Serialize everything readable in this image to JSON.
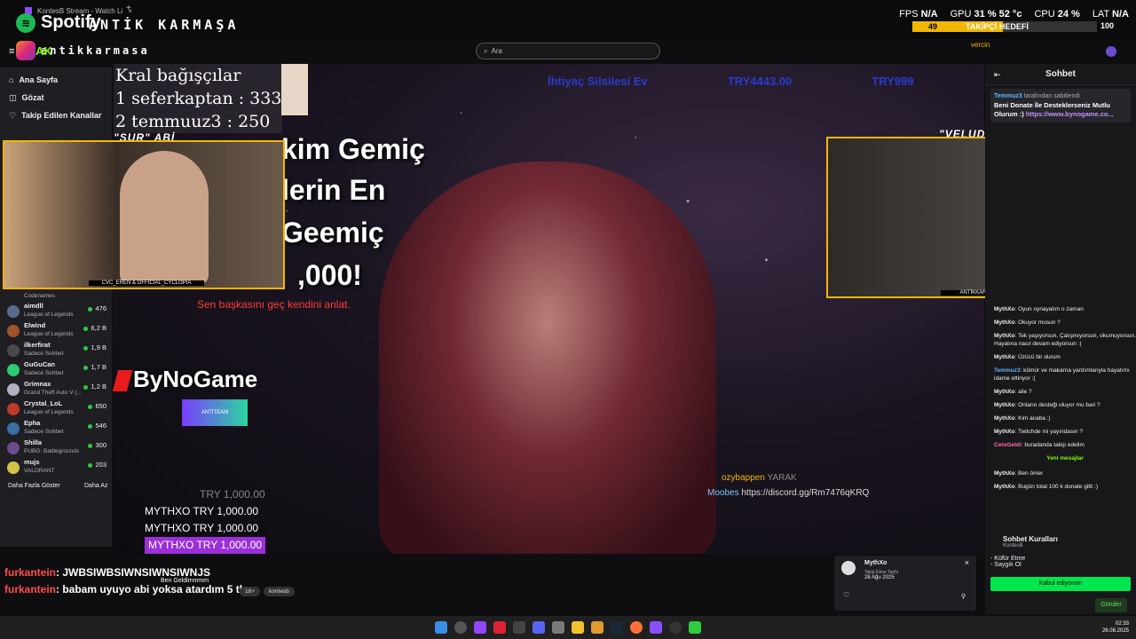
{
  "browser": {
    "tab_title": "KontesB Stream - Watch Li",
    "new_tab": "+",
    "spotify_label": "Spotify",
    "brand_title": "ANTİK KARMAŞA",
    "ig_handle": "antikkarmasa",
    "ig_badge": "AK"
  },
  "stats": {
    "fps_label": "FPS",
    "fps_value": "N/A",
    "gpu_label": "GPU",
    "gpu_value": "31 % 52 °c",
    "cpu_label": "CPU",
    "cpu_value": "24 %",
    "lat_label": "LAT",
    "lat_value": "N/A"
  },
  "follow_goal": {
    "current": "49",
    "label": "TAKİPÇİ HEDEFİ",
    "total": "100",
    "fraction": 0.49,
    "sub": "vercin"
  },
  "search": {
    "placeholder": "Ara"
  },
  "sidebar": {
    "nav": [
      {
        "label": "Ana Sayfa",
        "icon": "home-icon"
      },
      {
        "label": "Gözat",
        "icon": "browse-icon"
      },
      {
        "label": "Takip Edilen Kanallar",
        "icon": "heart-icon"
      }
    ],
    "top_game": "Codenames",
    "channels": [
      {
        "name": "aimdll",
        "game": "League of Legends",
        "viewers": "476",
        "color": "#5a6b8c"
      },
      {
        "name": "Elwind",
        "game": "League of Legends",
        "viewers": "6,2 B",
        "color": "#a0522d"
      },
      {
        "name": "ilkerfirat",
        "game": "Sadece Sohbet",
        "viewers": "1,9 B",
        "color": "#4a4a4a"
      },
      {
        "name": "GuGuCan",
        "game": "Sadece Sohbet",
        "viewers": "1,7 B",
        "color": "#2ecc71"
      },
      {
        "name": "Grimnax",
        "game": "Grand Theft Auto V (...",
        "viewers": "1,2 B",
        "color": "#b0b0c0"
      },
      {
        "name": "Crystal_LoL",
        "game": "League of Legends",
        "viewers": "650",
        "color": "#c0392b"
      },
      {
        "name": "Epha",
        "game": "Sadece Sohbet",
        "viewers": "546",
        "color": "#3a6ea5"
      },
      {
        "name": "Shilla",
        "game": "PUBG: Battlegrounds",
        "viewers": "300",
        "color": "#6b4c8c"
      },
      {
        "name": "mujs",
        "game": "VALORANT",
        "viewers": "203",
        "color": "#d4c34a"
      }
    ],
    "show_more": "Daha Fazla Göster",
    "show_less": "Daha Az"
  },
  "video": {
    "kral_lines": [
      "Kral bağışçılar",
      "1 seferkaptan : 333",
      "2 temmuuz3 : 250"
    ],
    "ticker": [
      "İhtiyaç Silsilesi Ev",
      "TRY4443.00",
      "TRY999"
    ],
    "big_lines": [
      "kim Gemiç",
      "lerin En",
      "Geemiç",
      ",000!"
    ],
    "red_message": "Sen başkasını geç kendini anlat.",
    "sponsor": "ByNoGame",
    "sponsor_badge": "ANTİTEAM",
    "donation_faded": "TRY 1,000.00",
    "donations": [
      "MYTHXO TRY 1,000.00",
      "MYTHXO TRY 1,000.00"
    ],
    "donation_highlight": "MYTHXO TRY 1,000.00",
    "discord_user1": "ozybappen",
    "discord_user1_text": "YARAK",
    "discord_user2": "Moobes",
    "discord_user2_text": "https://discord.gg/Rm7476qKRQ"
  },
  "cams": {
    "left_label": "\"SUR\" ABİ",
    "left_footer": "CVC_EREN & OFFICIAL_CYCLOPIA",
    "right_label": "\"VELUD\" ABİ",
    "right_footer": "ANTİKKARMAŞA"
  },
  "chat": {
    "title": "Sohbet",
    "pinned_by": "Temmuz3",
    "pinned_by_suffix": "tarafından sabitlendi",
    "pinned_text": "Beni Donate İle Desteklerseniz Mutlu Olurum :)",
    "pinned_link": "https://www.bynogame.co...",
    "messages": [
      {
        "user": "MythXo",
        "text": "Oyun oynayalım o zaman",
        "color": "#efeff1"
      },
      {
        "user": "MythXo",
        "text": "Okuyor musun ?",
        "color": "#efeff1"
      },
      {
        "user": "MythXo",
        "text": "Tek yaşıyorsun, Çalışmıyorsun, okumuyorsun. Hayatına nasıl devam ediyorsun :(",
        "color": "#efeff1"
      },
      {
        "user": "MythXo",
        "text": "Üzücü bir durum",
        "color": "#efeff1"
      },
      {
        "user": "Temmuz3",
        "text": "kömür ve makarna yardımlarıyla hayatımı idame ettiriyor :(",
        "color": "#58b7ff"
      },
      {
        "user": "MythXo",
        "text": "aile ?",
        "color": "#efeff1"
      },
      {
        "user": "MythXo",
        "text": "Onların desteği oluyor mu bari ?",
        "color": "#efeff1"
      },
      {
        "user": "MythXo",
        "text": "Kim acaba :)",
        "color": "#efeff1"
      },
      {
        "user": "MythXo",
        "text": "Twitchde mi yayındasın ?",
        "color": "#efeff1"
      },
      {
        "user": "CetoGeldi",
        "text": "buradanda takip edelim",
        "color": "#ff69b4"
      }
    ],
    "new_messages": "Yeni mesajlar",
    "messages_after": [
      {
        "user": "MythXo",
        "text": "Ben ömer",
        "color": "#efeff1"
      },
      {
        "user": "MythXo",
        "text": "Bugün total 100 k donate gitti :)",
        "color": "#efeff1"
      }
    ],
    "rules_title": "Sohbet Kuralları",
    "rules_channel": "KontesB",
    "rules": [
      "- Küfür Etme",
      "- Saygılı Ol"
    ],
    "accept_label": "Kabul ediyorum",
    "send_label": "Gönder"
  },
  "overlay_chat": [
    {
      "user": "furkantein",
      "text": ": JWBSIWBSIWNSIWNSIWNJS"
    },
    {
      "user": "furkantein",
      "text": ": babam uyuyo abi yoksa atardım 5 tl"
    }
  ],
  "overlay_ben": "Ben Geldimmmm",
  "tags": [
    "18+",
    "kontesb"
  ],
  "notification": {
    "user": "MythXo",
    "sub": "Takip Etme Tarihi",
    "date": "28 Ağu 2025"
  },
  "clock": {
    "time": "02:33",
    "date": "26.08.2025"
  }
}
